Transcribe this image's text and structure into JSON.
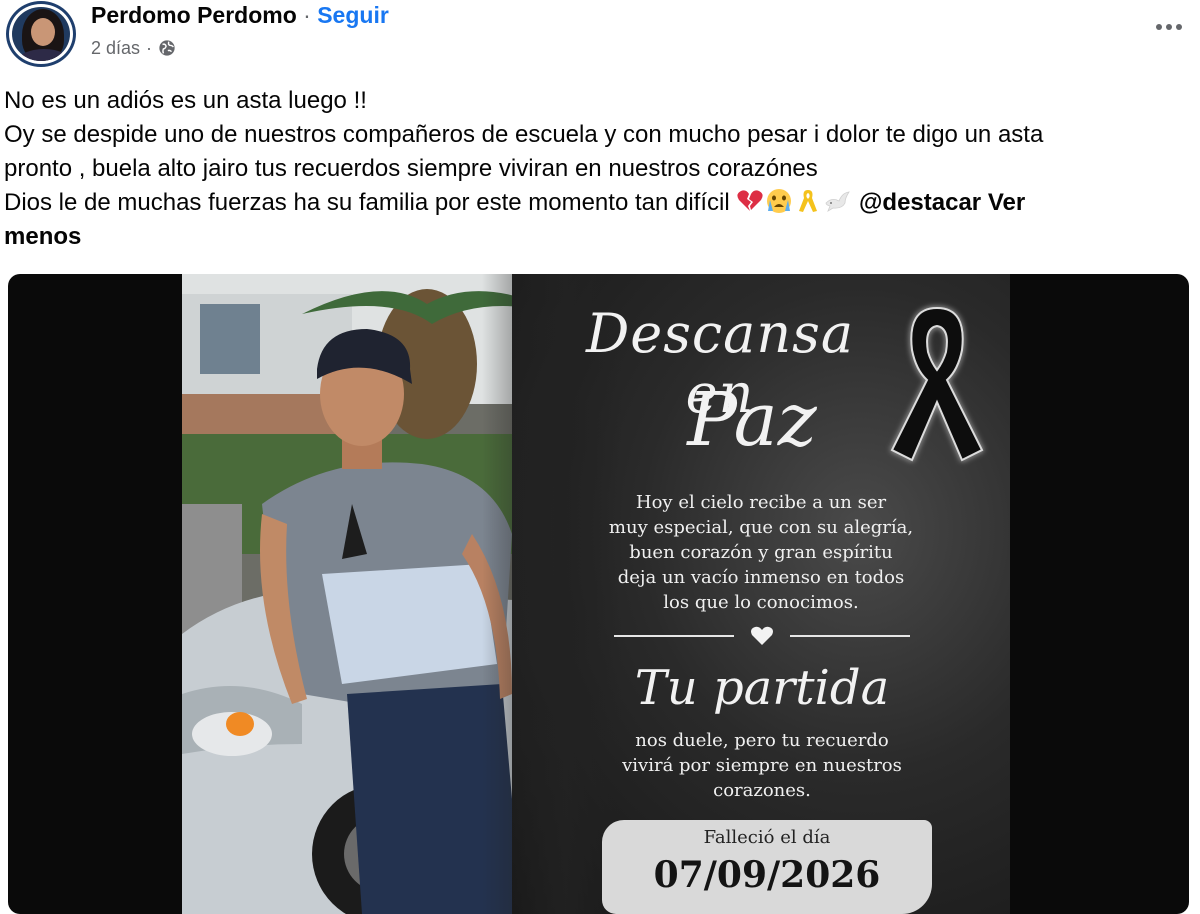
{
  "post": {
    "author": "Perdomo Perdomo",
    "separator": "·",
    "follow_label": "Seguir",
    "time_ago": "2 días",
    "meta_separator": "·",
    "audience_icon": "globe-icon",
    "more_icon": "more-options-icon"
  },
  "text": {
    "line1": "No es un adiós es un asta luego !!",
    "line2": "Oy se despide uno de nuestros compañeros  de escuela y con mucho pesar i dolor te digo un asta",
    "line3": "pronto , buela alto jairo tus recuerdos  siempre  viviran en nuestros  corazónes",
    "line4": "Dios le de muchas fuerzas  ha su familia por este momento tan difícil",
    "emojis": [
      "broken-heart-icon",
      "crying-face-icon",
      "ribbon-icon",
      "dove-icon"
    ],
    "mention": "@destacar",
    "see_less_part1": "Ver",
    "see_less_part2": "menos"
  },
  "image": {
    "title_line1": "Descansa en",
    "title_line2": "Paz",
    "message_lines": [
      "Hoy el cielo recibe a un ser",
      "muy especial, que con su alegría,",
      "buen corazón y gran espíritu",
      "deja un vacío inmenso en todos",
      "los que lo conocimos."
    ],
    "subtitle": "Tu partida",
    "message2_lines": [
      "nos duele, pero tu recuerdo",
      "vivirá por siempre en nuestros",
      "corazones."
    ],
    "date_label": "Falleció el día",
    "date_value": "07/09/2026"
  },
  "colors": {
    "link": "#1877f2",
    "secondary_text": "#65676b",
    "primary_text": "#050505"
  }
}
